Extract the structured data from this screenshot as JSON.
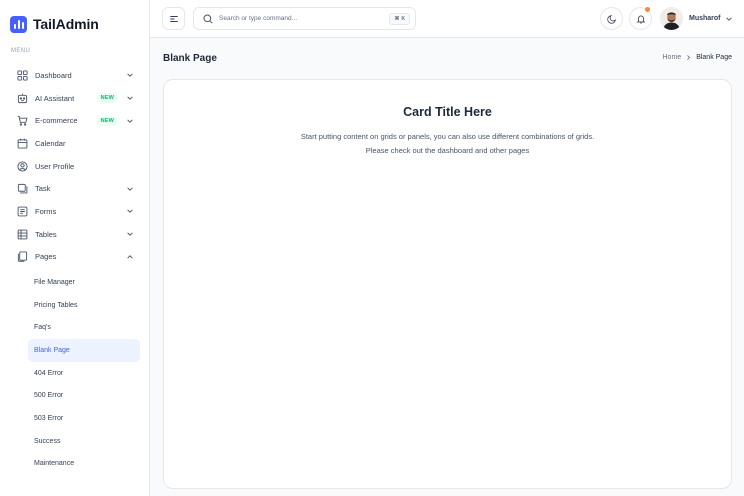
{
  "brand": {
    "name": "TailAdmin",
    "accent": "#465fff"
  },
  "sidebar": {
    "menu_label": "MENU",
    "items": [
      {
        "label": "Dashboard",
        "icon": "grid-icon",
        "chevron": "down"
      },
      {
        "label": "AI Assistant",
        "icon": "ai-icon",
        "badge": "NEW",
        "chevron": "down"
      },
      {
        "label": "E-commerce",
        "icon": "cart-icon",
        "badge": "NEW",
        "chevron": "down"
      },
      {
        "label": "Calendar",
        "icon": "calendar-icon"
      },
      {
        "label": "User Profile",
        "icon": "user-circle-icon"
      },
      {
        "label": "Task",
        "icon": "task-icon",
        "chevron": "down"
      },
      {
        "label": "Forms",
        "icon": "forms-icon",
        "chevron": "down"
      },
      {
        "label": "Tables",
        "icon": "table-icon",
        "chevron": "down"
      },
      {
        "label": "Pages",
        "icon": "pages-icon",
        "chevron": "up"
      }
    ],
    "sub_items": [
      {
        "label": "File Manager"
      },
      {
        "label": "Pricing Tables"
      },
      {
        "label": "Faq's"
      },
      {
        "label": "Blank Page",
        "active": true
      },
      {
        "label": "404 Error"
      },
      {
        "label": "500 Error"
      },
      {
        "label": "503 Error"
      },
      {
        "label": "Success"
      },
      {
        "label": "Maintenance"
      }
    ]
  },
  "header": {
    "search_placeholder": "Search or type command...",
    "shortcut": "⌘ K",
    "user_name": "Musharof"
  },
  "page": {
    "title": "Blank Page",
    "breadcrumb": {
      "home": "Home",
      "current": "Blank Page"
    },
    "card": {
      "title": "Card Title Here",
      "text_line1": "Start putting content on grids or panels, you can also use different combinations of grids.",
      "text_line2": "Please check out the dashboard and other pages"
    }
  }
}
